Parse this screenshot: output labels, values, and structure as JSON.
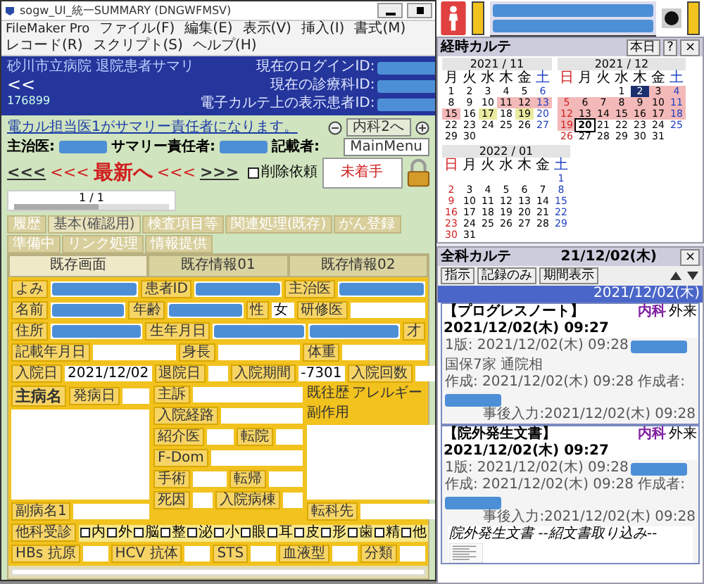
{
  "window": {
    "title": "sogw_UI_統一SUMMARY (DNGWFMSV)"
  },
  "menu": [
    "FileMaker Pro",
    "ファイル(F)",
    "編集(E)",
    "表示(V)",
    "挿入(I)",
    "書式(M)",
    "レコード(R)",
    "スクリプト(S)",
    "ヘルプ(H)"
  ],
  "header": {
    "title": "砂川市立病院 退院患者サマリ",
    "back": "<<",
    "record_no": "176899",
    "ids": [
      {
        "label": "現在のログインID:"
      },
      {
        "label": "現在の診療科ID:"
      },
      {
        "label": "電子カルテ上の表示患者ID:"
      }
    ]
  },
  "notice": "電カル担当医1がサマリー責任者になります。",
  "dept_button": "内科2へ",
  "main_menu": "MainMenu",
  "doctors": [
    {
      "label": "主治医:",
      "masked": true
    },
    {
      "label": "サマリー責任者:",
      "masked": true
    },
    {
      "label": "記載者:",
      "masked": false
    }
  ],
  "nav": [
    {
      "text": "<<<",
      "kind": "link"
    },
    {
      "text": "<<<",
      "kind": "arrow"
    },
    {
      "text": "最新へ",
      "kind": "latest"
    },
    {
      "text": "<<<",
      "kind": "arrow"
    },
    {
      "text": ">>>",
      "kind": "link"
    }
  ],
  "delete_request": {
    "label": "削除依頼",
    "checked": false
  },
  "status": "未着手",
  "pager": "1 / 1",
  "tabs": [
    {
      "label": "履歴",
      "selected": false
    },
    {
      "label": "基本(確認用)",
      "selected": true
    },
    {
      "label": "検査項目等",
      "selected": false
    },
    {
      "label": "関連処理(既存)",
      "selected": false
    },
    {
      "label": "がん登録",
      "selected": false
    },
    {
      "label": "準備中",
      "selected": false
    },
    {
      "label": "リンク処理",
      "selected": false
    },
    {
      "label": "情報提供",
      "selected": false
    }
  ],
  "subtabs": [
    {
      "label": "既存画面",
      "selected": true
    },
    {
      "label": "既存情報01",
      "selected": false
    },
    {
      "label": "既存情報02",
      "selected": false
    }
  ],
  "form": {
    "top_rows": [
      [
        {
          "kind": "label",
          "text": "よみ"
        },
        {
          "kind": "field",
          "masked": true
        },
        {
          "kind": "label",
          "text": "患者ID"
        },
        {
          "kind": "field",
          "masked": true
        },
        {
          "kind": "label",
          "text": "主治医"
        },
        {
          "kind": "field",
          "masked": true
        }
      ],
      [
        {
          "kind": "label",
          "text": "名前"
        },
        {
          "kind": "field",
          "masked": true
        },
        {
          "kind": "label",
          "text": "年齢"
        },
        {
          "kind": "field",
          "masked": true
        },
        {
          "kind": "label",
          "text": "性"
        },
        {
          "kind": "field",
          "masked": false,
          "value": "女"
        },
        {
          "kind": "label",
          "text": "研修医"
        },
        {
          "kind": "field",
          "masked": false
        }
      ],
      [
        {
          "kind": "label",
          "text": "住所"
        },
        {
          "kind": "field",
          "masked": true
        },
        {
          "kind": "label",
          "text": "生年月日"
        },
        {
          "kind": "field",
          "masked": true
        },
        {
          "kind": "field",
          "masked": true
        },
        {
          "kind": "label",
          "text": "才"
        }
      ],
      [
        {
          "kind": "label",
          "text": "記載年月日"
        },
        {
          "kind": "field",
          "masked": false
        },
        {
          "kind": "label",
          "text": "身長"
        },
        {
          "kind": "field",
          "masked": false
        },
        {
          "kind": "label",
          "text": "体重"
        },
        {
          "kind": "field",
          "masked": false
        }
      ],
      [
        {
          "kind": "label",
          "text": "入院日"
        },
        {
          "kind": "field",
          "masked": false,
          "value": "2021/12/02"
        },
        {
          "kind": "label",
          "text": "退院日"
        },
        {
          "kind": "field",
          "masked": false
        },
        {
          "kind": "label",
          "text": "入院期間"
        },
        {
          "kind": "field",
          "masked": false,
          "value": "-7301"
        },
        {
          "kind": "label",
          "text": "入院回数"
        },
        {
          "kind": "field",
          "masked": false
        }
      ]
    ],
    "columns": [
      [
        [
          {
            "kind": "heading",
            "text": "主病名"
          },
          {
            "kind": "label",
            "text": "発病日"
          },
          {
            "kind": "field",
            "masked": false
          }
        ],
        [
          {
            "kind": "area"
          }
        ],
        [
          {
            "kind": "label",
            "text": "副病名1"
          },
          {
            "kind": "field",
            "masked": false
          }
        ]
      ],
      [
        [
          {
            "kind": "label",
            "text": "主訴"
          },
          {
            "kind": "field",
            "masked": false
          }
        ],
        [
          {
            "kind": "label",
            "text": "入院経路"
          },
          {
            "kind": "field",
            "masked": false
          }
        ],
        [
          {
            "kind": "label",
            "text": "紹介医"
          },
          {
            "kind": "field",
            "masked": false
          },
          {
            "kind": "label",
            "text": "転院"
          },
          {
            "kind": "field",
            "masked": false
          }
        ],
        [
          {
            "kind": "label",
            "text": "F-Dom"
          },
          {
            "kind": "field",
            "masked": false
          }
        ],
        [
          {
            "kind": "label",
            "text": "手術"
          },
          {
            "kind": "field",
            "masked": false
          },
          {
            "kind": "label",
            "text": "転帰"
          },
          {
            "kind": "field",
            "masked": false
          }
        ],
        [
          {
            "kind": "label",
            "text": "死因"
          },
          {
            "kind": "field",
            "masked": false
          },
          {
            "kind": "label",
            "text": "入院病棟"
          },
          {
            "kind": "field",
            "masked": false
          }
        ]
      ],
      [
        [
          {
            "kind": "text",
            "text": "既往歴"
          },
          {
            "kind": "text",
            "text": "アレルギー"
          }
        ],
        [
          {
            "kind": "text",
            "text": "副作用"
          }
        ],
        [
          {
            "kind": "area"
          }
        ],
        [
          {
            "kind": "label",
            "text": "転科先"
          },
          {
            "kind": "field",
            "masked": false
          }
        ]
      ]
    ],
    "bottom_rows": [
      [
        {
          "kind": "label",
          "text": "他科受診"
        },
        {
          "kind": "check",
          "label": "内",
          "checked": false
        },
        {
          "kind": "check",
          "label": "外",
          "checked": false
        },
        {
          "kind": "check",
          "label": "脳",
          "checked": false
        },
        {
          "kind": "check",
          "label": "整",
          "checked": false
        },
        {
          "kind": "check",
          "label": "泌",
          "checked": false
        },
        {
          "kind": "check",
          "label": "小",
          "checked": false
        },
        {
          "kind": "check",
          "label": "眼",
          "checked": false
        },
        {
          "kind": "check",
          "label": "耳",
          "checked": false
        },
        {
          "kind": "check",
          "label": "皮",
          "checked": false
        },
        {
          "kind": "check",
          "label": "形",
          "checked": false
        },
        {
          "kind": "check",
          "label": "歯",
          "checked": false
        },
        {
          "kind": "check",
          "label": "精",
          "checked": false
        },
        {
          "kind": "check",
          "label": "他",
          "checked": false
        }
      ],
      [
        {
          "kind": "label",
          "text": "HBs 抗原"
        },
        {
          "kind": "field",
          "masked": false
        },
        {
          "kind": "label",
          "text": "HCV 抗体"
        },
        {
          "kind": "field",
          "masked": false
        },
        {
          "kind": "label",
          "text": "STS"
        },
        {
          "kind": "field",
          "masked": false
        },
        {
          "kind": "label",
          "text": "血液型"
        },
        {
          "kind": "field",
          "masked": false
        },
        {
          "kind": "label",
          "text": "分類"
        },
        {
          "kind": "field",
          "masked": false
        }
      ]
    ]
  },
  "calendar": {
    "title": "経時カルテ",
    "today_button": "本日",
    "help": "?",
    "close": "×",
    "months": [
      {
        "label": "2021 / 11",
        "weekdays": [
          "月",
          "火",
          "水",
          "木",
          "金",
          "土"
        ],
        "weeks": [
          [
            {
              "d": "1",
              "kind": "plain"
            },
            {
              "d": "2",
              "kind": "plain"
            },
            {
              "d": "3",
              "kind": "plain"
            },
            {
              "d": "4",
              "kind": "plain"
            },
            {
              "d": "5",
              "kind": "plain"
            },
            {
              "d": "6",
              "kind": "plain"
            }
          ],
          [
            {
              "d": "8",
              "kind": "plain"
            },
            {
              "d": "9",
              "kind": "plain"
            },
            {
              "d": "10",
              "kind": "plain"
            },
            {
              "d": "11",
              "kind": "range"
            },
            {
              "d": "12",
              "kind": "range"
            },
            {
              "d": "13",
              "kind": "range"
            }
          ],
          [
            {
              "d": "15",
              "kind": "range"
            },
            {
              "d": "16",
              "kind": "plain"
            },
            {
              "d": "17",
              "kind": "alt"
            },
            {
              "d": "18",
              "kind": "plain"
            },
            {
              "d": "19",
              "kind": "alt"
            },
            {
              "d": "20",
              "kind": "plain"
            }
          ],
          [
            {
              "d": "22",
              "kind": "plain"
            },
            {
              "d": "23",
              "kind": "plain"
            },
            {
              "d": "24",
              "kind": "plain"
            },
            {
              "d": "25",
              "kind": "plain"
            },
            {
              "d": "26",
              "kind": "plain"
            },
            {
              "d": "27",
              "kind": "plain"
            }
          ],
          [
            {
              "d": "29",
              "kind": "plain"
            },
            {
              "d": "30",
              "kind": "plain"
            }
          ]
        ]
      },
      {
        "label": "2021 / 12",
        "weekdays": [
          "日",
          "月",
          "火",
          "水",
          "木",
          "金",
          "土"
        ],
        "weeks": [
          [
            {
              "kind": "blank"
            },
            {
              "kind": "blank"
            },
            {
              "kind": "blank"
            },
            {
              "d": "1",
              "kind": "plain"
            },
            {
              "d": "2",
              "kind": "selected"
            },
            {
              "d": "3",
              "kind": "range"
            },
            {
              "d": "4",
              "kind": "range"
            }
          ],
          [
            {
              "d": "5",
              "kind": "range"
            },
            {
              "d": "6",
              "kind": "range"
            },
            {
              "d": "7",
              "kind": "range"
            },
            {
              "d": "8",
              "kind": "range"
            },
            {
              "d": "9",
              "kind": "range"
            },
            {
              "d": "10",
              "kind": "range"
            },
            {
              "d": "11",
              "kind": "range"
            }
          ],
          [
            {
              "d": "12",
              "kind": "range"
            },
            {
              "d": "13",
              "kind": "range"
            },
            {
              "d": "14",
              "kind": "range"
            },
            {
              "d": "15",
              "kind": "range"
            },
            {
              "d": "16",
              "kind": "range"
            },
            {
              "d": "17",
              "kind": "range"
            },
            {
              "d": "18",
              "kind": "range"
            }
          ],
          [
            {
              "d": "19",
              "kind": "range"
            },
            {
              "d": "20",
              "kind": "today"
            },
            {
              "d": "21",
              "kind": "plain"
            },
            {
              "d": "22",
              "kind": "plain"
            },
            {
              "d": "23",
              "kind": "plain"
            },
            {
              "d": "24",
              "kind": "plain"
            },
            {
              "d": "25",
              "kind": "plain"
            }
          ],
          [
            {
              "d": "26",
              "kind": "plain"
            },
            {
              "d": "27",
              "kind": "plain"
            },
            {
              "d": "28",
              "kind": "plain"
            },
            {
              "d": "29",
              "kind": "plain"
            },
            {
              "d": "30",
              "kind": "plain"
            },
            {
              "d": "31",
              "kind": "plain"
            }
          ]
        ]
      },
      {
        "label": "2022 / 01",
        "weekdays": [
          "日",
          "月",
          "火",
          "水",
          "木",
          "金",
          "土"
        ],
        "weeks": [
          [
            {
              "kind": "blank"
            },
            {
              "kind": "blank"
            },
            {
              "kind": "blank"
            },
            {
              "kind": "blank"
            },
            {
              "kind": "blank"
            },
            {
              "kind": "blank"
            },
            {
              "d": "1",
              "kind": "plain"
            }
          ],
          [
            {
              "d": "2",
              "kind": "plain"
            },
            {
              "d": "3",
              "kind": "plain"
            },
            {
              "d": "4",
              "kind": "plain"
            },
            {
              "d": "5",
              "kind": "plain"
            },
            {
              "d": "6",
              "kind": "plain"
            },
            {
              "d": "7",
              "kind": "plain"
            },
            {
              "d": "8",
              "kind": "plain"
            }
          ],
          [
            {
              "d": "9",
              "kind": "plain"
            },
            {
              "d": "10",
              "kind": "plain"
            },
            {
              "d": "11",
              "kind": "plain"
            },
            {
              "d": "12",
              "kind": "plain"
            },
            {
              "d": "13",
              "kind": "plain"
            },
            {
              "d": "14",
              "kind": "plain"
            },
            {
              "d": "15",
              "kind": "plain"
            }
          ],
          [
            {
              "d": "16",
              "kind": "plain"
            },
            {
              "d": "17",
              "kind": "plain"
            },
            {
              "d": "18",
              "kind": "plain"
            },
            {
              "d": "19",
              "kind": "plain"
            },
            {
              "d": "20",
              "kind": "plain"
            },
            {
              "d": "21",
              "kind": "plain"
            },
            {
              "d": "22",
              "kind": "plain"
            }
          ],
          [
            {
              "d": "23",
              "kind": "plain"
            },
            {
              "d": "24",
              "kind": "plain"
            },
            {
              "d": "25",
              "kind": "plain"
            },
            {
              "d": "26",
              "kind": "plain"
            },
            {
              "d": "27",
              "kind": "plain"
            },
            {
              "d": "28",
              "kind": "plain"
            },
            {
              "d": "29",
              "kind": "plain"
            }
          ],
          [
            {
              "d": "30",
              "kind": "plain"
            },
            {
              "d": "31",
              "kind": "plain"
            }
          ]
        ]
      }
    ]
  },
  "chart": {
    "title": "全科カルテ",
    "date": "21/12/02(木)",
    "close": "×",
    "tools": [
      "指示",
      "記録のみ",
      "期間表示"
    ],
    "day_header": "2021/12/02(木)",
    "entries": [
      {
        "title": "【プログレスノート】2021/12/02(木) 09:27",
        "dept": "内科",
        "visit": "外来",
        "lines": [
          {
            "kind": "detail",
            "text": "1版: 2021/12/02(木) 09:28",
            "masked": true,
            "note": "国保7家 通院相"
          },
          {
            "kind": "detail",
            "text": "作成: 2021/12/02(木) 09:28 作成者:",
            "masked": true
          },
          {
            "kind": "footer",
            "text": "事後入力:2021/12/02(木) 09:28"
          }
        ]
      },
      {
        "title": "【院外発生文書】2021/12/02(木) 09:27",
        "dept": "内科",
        "visit": "外来",
        "lines": [
          {
            "kind": "detail",
            "text": "1版: 2021/12/02(木) 09:28",
            "masked": true
          },
          {
            "kind": "detail",
            "text": "作成: 2021/12/02(木) 09:28 作成者:",
            "masked": true
          },
          {
            "kind": "footer",
            "text": "事後入力:2021/12/02(木) 09:28"
          }
        ],
        "attachment": "院外発生文書 --紹文書取り込み--"
      }
    ]
  }
}
